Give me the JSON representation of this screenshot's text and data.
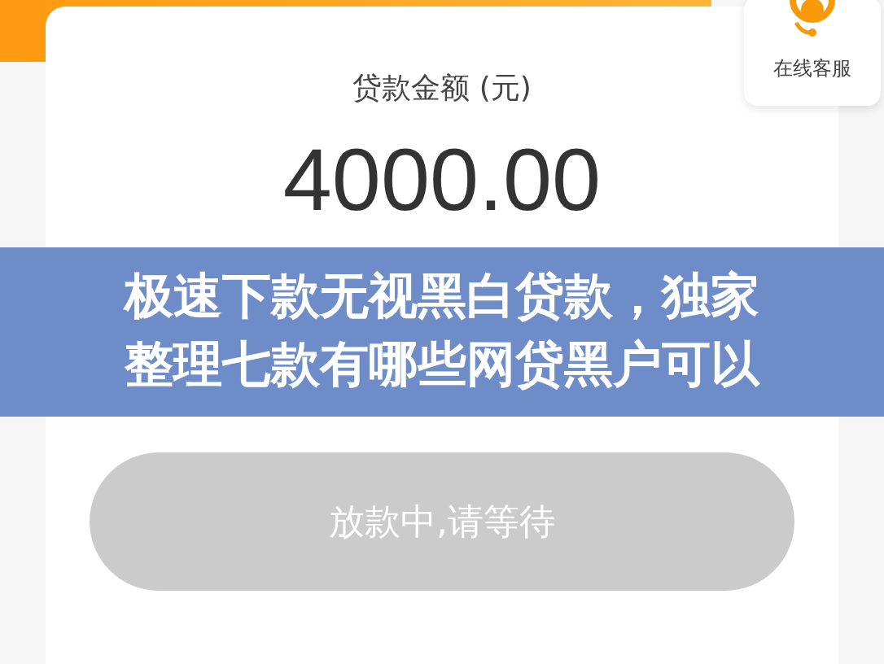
{
  "loan_card": {
    "amount_label": "贷款金额 (元)",
    "amount": "4000.00"
  },
  "submit_button": {
    "label": "放款中,请等待",
    "disabled": true
  },
  "customer_service": {
    "label": "在线客服"
  },
  "banner": {
    "lines": [
      "极速下款无视黑白贷款，独家",
      "整理七款有哪些网贷黑户可以"
    ]
  }
}
